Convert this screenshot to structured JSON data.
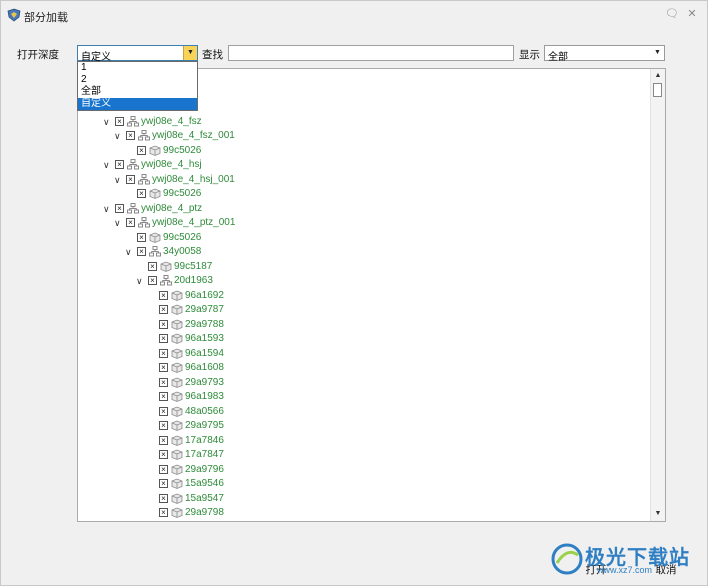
{
  "window": {
    "title": "部分加载",
    "help_glyph": "🗨",
    "close_glyph": "✕"
  },
  "toolbar": {
    "depth_label": "打开深度",
    "depth_value": "自定义",
    "search_label": "查找",
    "search_value": "",
    "display_label": "显示",
    "display_value": "全部"
  },
  "dropdown": {
    "options": [
      "1",
      "2",
      "全部",
      "自定义"
    ],
    "selected_index": 3
  },
  "tree": {
    "rows": [
      {
        "level": 2,
        "chevron": "",
        "text": ""
      },
      {
        "level": 2,
        "chevron": "",
        "text": ""
      },
      {
        "level": 2,
        "chevron": "",
        "text": ""
      },
      {
        "level": 2,
        "chevron": "∨",
        "icon": "assembly",
        "text": "ywj08e_4_fsz"
      },
      {
        "level": 3,
        "chevron": "∨",
        "icon": "assembly",
        "text": "ywj08e_4_fsz_001"
      },
      {
        "level": 4,
        "chevron": "",
        "icon": "part",
        "text": "99c5026"
      },
      {
        "level": 2,
        "chevron": "∨",
        "icon": "assembly",
        "text": "ywj08e_4_hsj"
      },
      {
        "level": 3,
        "chevron": "∨",
        "icon": "assembly",
        "text": "ywj08e_4_hsj_001"
      },
      {
        "level": 4,
        "chevron": "",
        "icon": "part",
        "text": "99c5026"
      },
      {
        "level": 2,
        "chevron": "∨",
        "icon": "assembly",
        "text": "ywj08e_4_ptz"
      },
      {
        "level": 3,
        "chevron": "∨",
        "icon": "assembly",
        "text": "ywj08e_4_ptz_001"
      },
      {
        "level": 4,
        "chevron": "",
        "icon": "part",
        "text": "99c5026"
      },
      {
        "level": 4,
        "chevron": "∨",
        "icon": "assembly",
        "text": "34y0058"
      },
      {
        "level": 5,
        "chevron": "",
        "icon": "part",
        "text": "99c5187"
      },
      {
        "level": 5,
        "chevron": "∨",
        "icon": "assembly",
        "text": "20d1963"
      },
      {
        "level": 6,
        "chevron": "",
        "icon": "part",
        "text": "96a1692"
      },
      {
        "level": 6,
        "chevron": "",
        "icon": "part",
        "text": "29a9787"
      },
      {
        "level": 6,
        "chevron": "",
        "icon": "part",
        "text": "29a9788"
      },
      {
        "level": 6,
        "chevron": "",
        "icon": "part",
        "text": "96a1593"
      },
      {
        "level": 6,
        "chevron": "",
        "icon": "part",
        "text": "96a1594"
      },
      {
        "level": 6,
        "chevron": "",
        "icon": "part",
        "text": "96a1608"
      },
      {
        "level": 6,
        "chevron": "",
        "icon": "part",
        "text": "29a9793"
      },
      {
        "level": 6,
        "chevron": "",
        "icon": "part",
        "text": "96a1983"
      },
      {
        "level": 6,
        "chevron": "",
        "icon": "part",
        "text": "48a0566"
      },
      {
        "level": 6,
        "chevron": "",
        "icon": "part",
        "text": "29a9795"
      },
      {
        "level": 6,
        "chevron": "",
        "icon": "part",
        "text": "17a7846"
      },
      {
        "level": 6,
        "chevron": "",
        "icon": "part",
        "text": "17a7847"
      },
      {
        "level": 6,
        "chevron": "",
        "icon": "part",
        "text": "29a9796"
      },
      {
        "level": 6,
        "chevron": "",
        "icon": "part",
        "text": "15a9546"
      },
      {
        "level": 6,
        "chevron": "",
        "icon": "part",
        "text": "15a9547"
      },
      {
        "level": 6,
        "chevron": "",
        "icon": "part",
        "text": "29a9798"
      }
    ]
  },
  "footer": {
    "open_label": "打开",
    "cancel_label": "取消"
  },
  "watermark": {
    "text": "极光下载站",
    "url": "www.xz7.com"
  },
  "colors": {
    "tree_text": "#2e8b3a",
    "selection": "#1874cd",
    "combo_arrow": "#f7d35a",
    "watermark": "#2e7fc4"
  }
}
